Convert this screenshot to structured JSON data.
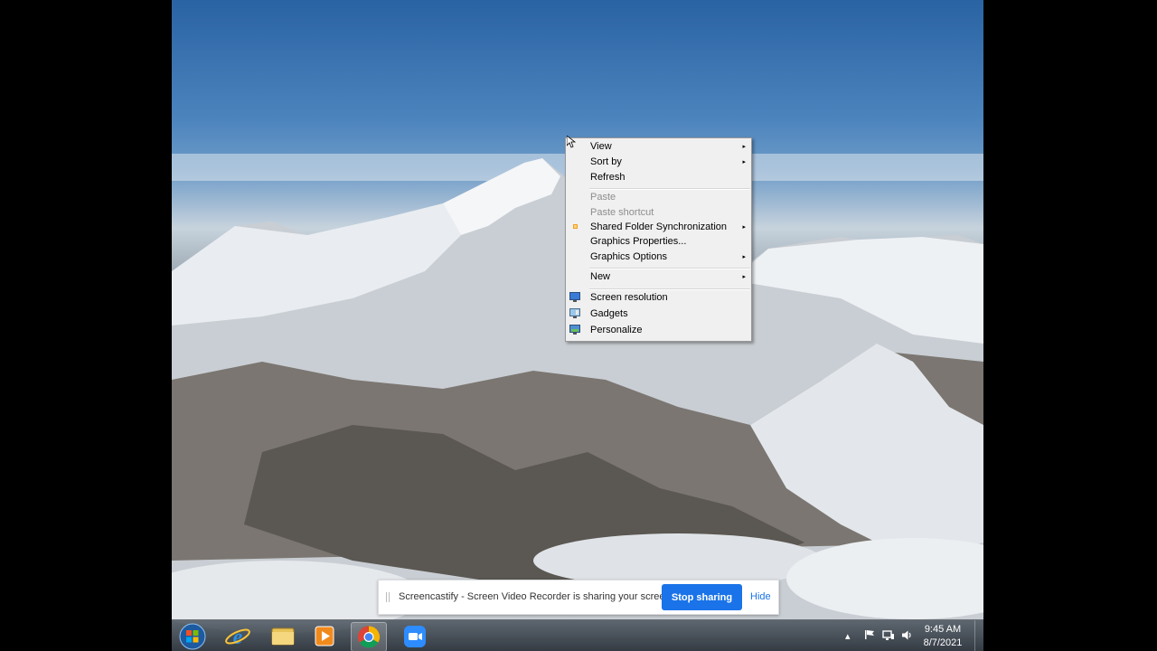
{
  "context_menu": {
    "items": [
      {
        "label": "View",
        "arrow": "▸"
      },
      {
        "label": "Sort by",
        "arrow": "▸"
      },
      {
        "label": "Refresh"
      },
      {
        "label": "Paste"
      },
      {
        "label": "Paste shortcut"
      },
      {
        "label": "Shared Folder Synchronization",
        "arrow": "▸"
      },
      {
        "label": "Graphics Properties..."
      },
      {
        "label": "Graphics Options",
        "arrow": "▸"
      },
      {
        "label": "New",
        "arrow": "▸"
      },
      {
        "label": "Screen resolution"
      },
      {
        "label": "Gadgets"
      },
      {
        "label": "Personalize"
      }
    ]
  },
  "share_bar": {
    "message": "Screencastify - Screen Video Recorder is sharing your screen.",
    "stop_label": "Stop sharing",
    "hide_label": "Hide"
  },
  "taskbar": {
    "apps": [
      "start-orb-icon",
      "internet-explorer-icon",
      "file-explorer-icon",
      "media-player-icon",
      "chrome-icon",
      "zoom-icon"
    ],
    "tray": {
      "show_hidden": "▴"
    },
    "clock": {
      "time": "9:45 AM",
      "date": "8/7/2021"
    }
  },
  "colors": {
    "accent": "#1a73e8",
    "menu_bg": "#f0f0f0",
    "sky": "#2a63a3"
  }
}
